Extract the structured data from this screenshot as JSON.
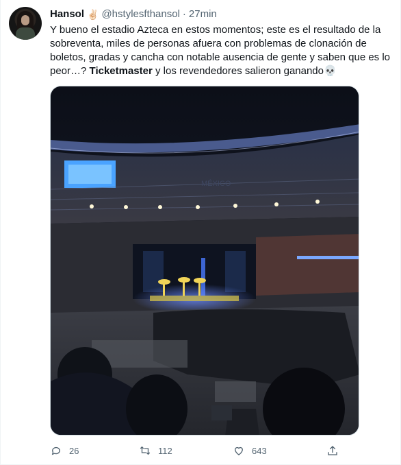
{
  "tweet": {
    "author_name": "Hansol",
    "author_emoji": "✌🏻",
    "handle": "@hstylesfthansol",
    "separator": "·",
    "time": "27min",
    "text_lines": [
      "Y bueno el estadio Azteca en estos momentos; este es el resultado de la",
      "sobreventa, miles de personas afuera con problemas de clonación de",
      "boletos, gradas y cancha con notable ausencia de gente y saben que es lo",
      "peor…? "
    ],
    "text_bold": "Ticketmaster",
    "text_tail": " y los revendedores salieron ganando",
    "text_end_emoji": "💀"
  },
  "media": {
    "stadium_sign": "MÉXICO"
  },
  "actions": {
    "replies": "26",
    "retweets": "112",
    "likes": "643"
  },
  "icons": [
    "reply-icon",
    "retweet-icon",
    "like-icon",
    "share-icon"
  ],
  "colors": {
    "text": "#0f1419",
    "secondary": "#536471",
    "border": "#cfd9de"
  }
}
